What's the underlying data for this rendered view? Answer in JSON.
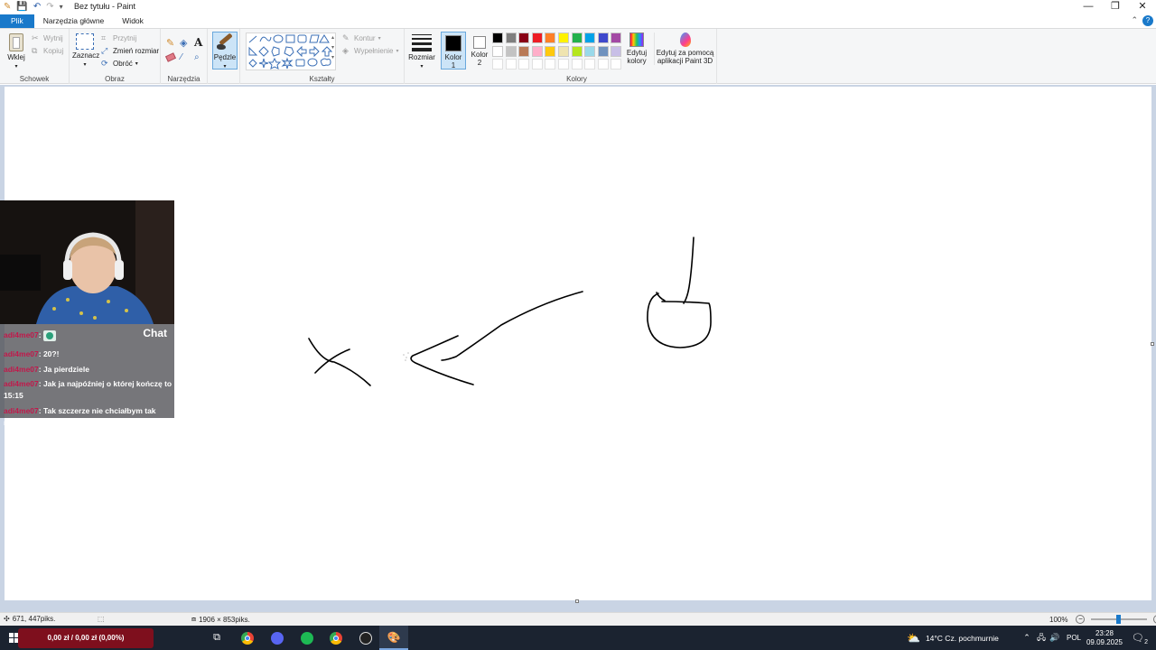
{
  "window": {
    "title": "Bez tytułu - Paint"
  },
  "tabs": {
    "file": "Plik",
    "home": "Narzędzia główne",
    "view": "Widok"
  },
  "ribbon": {
    "clipboard": {
      "label": "Schowek",
      "paste": "Wklej",
      "cut": "Wytnij",
      "copy": "Kopiuj"
    },
    "image": {
      "label": "Obraz",
      "select": "Zaznacz",
      "crop": "Przytnij",
      "resize": "Zmień rozmiar",
      "rotate": "Obróć"
    },
    "tools": {
      "label": "Narzędzia",
      "brushes": "Pędzle"
    },
    "shapes": {
      "label": "Kształty",
      "outline": "Kontur",
      "fill": "Wypełnienie"
    },
    "size": "Rozmiar",
    "colors": {
      "label": "Kolory",
      "color1": "Kolor 1",
      "color2": "Kolor 2",
      "edit": "Edytuj kolory",
      "paint3d": "Edytuj za pomocą aplikacji Paint 3D",
      "row1": [
        "#000000",
        "#7f7f7f",
        "#880015",
        "#ed1c24",
        "#ff7f27",
        "#fff200",
        "#22b14c",
        "#00a2e8",
        "#3f48cc",
        "#a349a4"
      ],
      "row2": [
        "#ffffff",
        "#c3c3c3",
        "#b97a57",
        "#ffaec9",
        "#ffc90e",
        "#efe4b0",
        "#b5e61d",
        "#99d9ea",
        "#7092be",
        "#c8bfe7"
      ]
    }
  },
  "chat": {
    "title": "Chat",
    "messages": [
      {
        "user": "adi4me07",
        "text": ""
      },
      {
        "user": "adi4me07",
        "text": "20?!"
      },
      {
        "user": "adi4me07",
        "text": "Ja pierdziele"
      },
      {
        "user": "adi4me07",
        "text": "Jak ja najpóźniej o której kończę to 15:15"
      },
      {
        "user": "adi4me07",
        "text": "Tak szczerze nie chciałbym tak mieć"
      }
    ]
  },
  "statusbar": {
    "cursor": "671, 447piks.",
    "dimensions": "1906 × 853piks.",
    "zoom": "100%"
  },
  "taskbar": {
    "donation": "0,00 zł / 0,00 zł (0,00%)",
    "weather": "14°C  Cz. pochmurnie",
    "lang": "POL",
    "time": "23:28",
    "date": "09.09.2025",
    "notif_count": "2"
  }
}
